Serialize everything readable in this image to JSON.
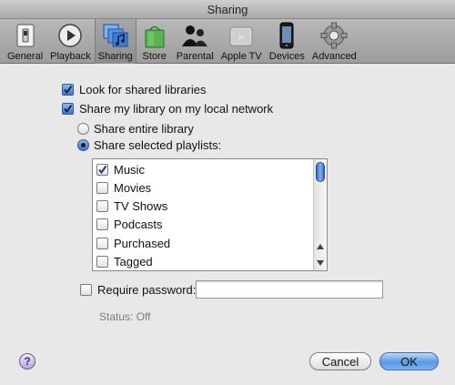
{
  "window": {
    "title": "Sharing"
  },
  "toolbar": {
    "items": [
      {
        "label": "General",
        "icon": "switch-icon"
      },
      {
        "label": "Playback",
        "icon": "play-icon"
      },
      {
        "label": "Sharing",
        "icon": "music-folders-icon",
        "selected": true
      },
      {
        "label": "Store",
        "icon": "shopping-bag-icon"
      },
      {
        "label": "Parental",
        "icon": "people-icon"
      },
      {
        "label": "Apple TV",
        "icon": "apple-tv-icon"
      },
      {
        "label": "Devices",
        "icon": "iphone-icon"
      },
      {
        "label": "Advanced",
        "icon": "gear-icon"
      }
    ]
  },
  "options": {
    "look_shared": {
      "label": "Look for shared libraries",
      "checked": true
    },
    "share_library": {
      "label": "Share my library on my local network",
      "checked": true
    },
    "share_entire": {
      "label": "Share entire library",
      "selected": false
    },
    "share_selected": {
      "label": "Share selected playlists:",
      "selected": true
    }
  },
  "playlists": [
    {
      "label": "Music",
      "checked": true
    },
    {
      "label": "Movies",
      "checked": false
    },
    {
      "label": "TV Shows",
      "checked": false
    },
    {
      "label": "Podcasts",
      "checked": false
    },
    {
      "label": "Purchased",
      "checked": false
    },
    {
      "label": "Tagged",
      "checked": false
    }
  ],
  "password": {
    "label": "Require password:",
    "checked": false,
    "value": ""
  },
  "status": {
    "text": "Status: Off"
  },
  "buttons": {
    "help": "?",
    "cancel": "Cancel",
    "ok": "OK"
  },
  "colors": {
    "accent": "#3a78cf",
    "default_button": "#5b9ae6"
  }
}
